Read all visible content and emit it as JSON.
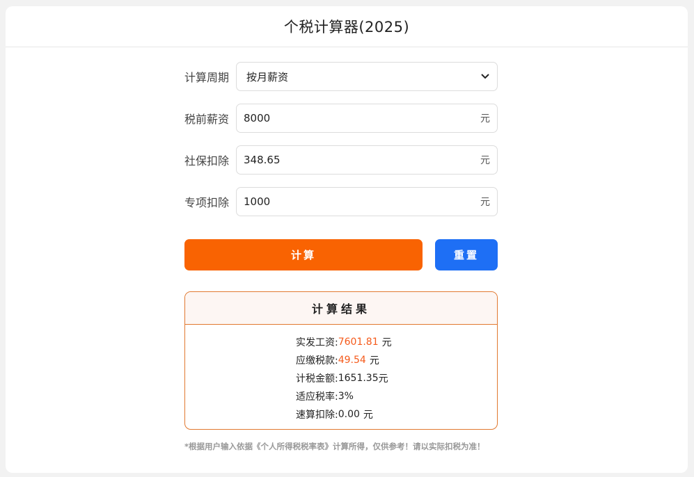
{
  "header": {
    "title": "个税计算器(2025)"
  },
  "form": {
    "period": {
      "label": "计算周期",
      "value": "按月薪资"
    },
    "salary": {
      "label": "税前薪资",
      "value": "8000",
      "unit": "元"
    },
    "social": {
      "label": "社保扣除",
      "value": "348.65",
      "unit": "元"
    },
    "special": {
      "label": "专项扣除",
      "value": "1000",
      "unit": "元"
    }
  },
  "buttons": {
    "calc": "计算",
    "reset": "重置"
  },
  "result": {
    "title": "计算结果",
    "actual_label": "实发工资:",
    "actual_value": "7601.81",
    "tax_label": "应缴税款:",
    "tax_value": "49.54",
    "taxable_label": "计税金额:",
    "taxable_value": "1651.35",
    "rate_label": "适应税率:",
    "rate_value": "3%",
    "quick_label": "速算扣除:",
    "quick_value": "0.00",
    "unit": "元"
  },
  "note": "*根据用户输入依据《个人所得税税率表》计算所得，仅供参考！请以实际扣税为准！",
  "colors": {
    "accent_orange": "#f96302",
    "accent_blue": "#1e6ff5",
    "highlight": "#f55a1b"
  }
}
